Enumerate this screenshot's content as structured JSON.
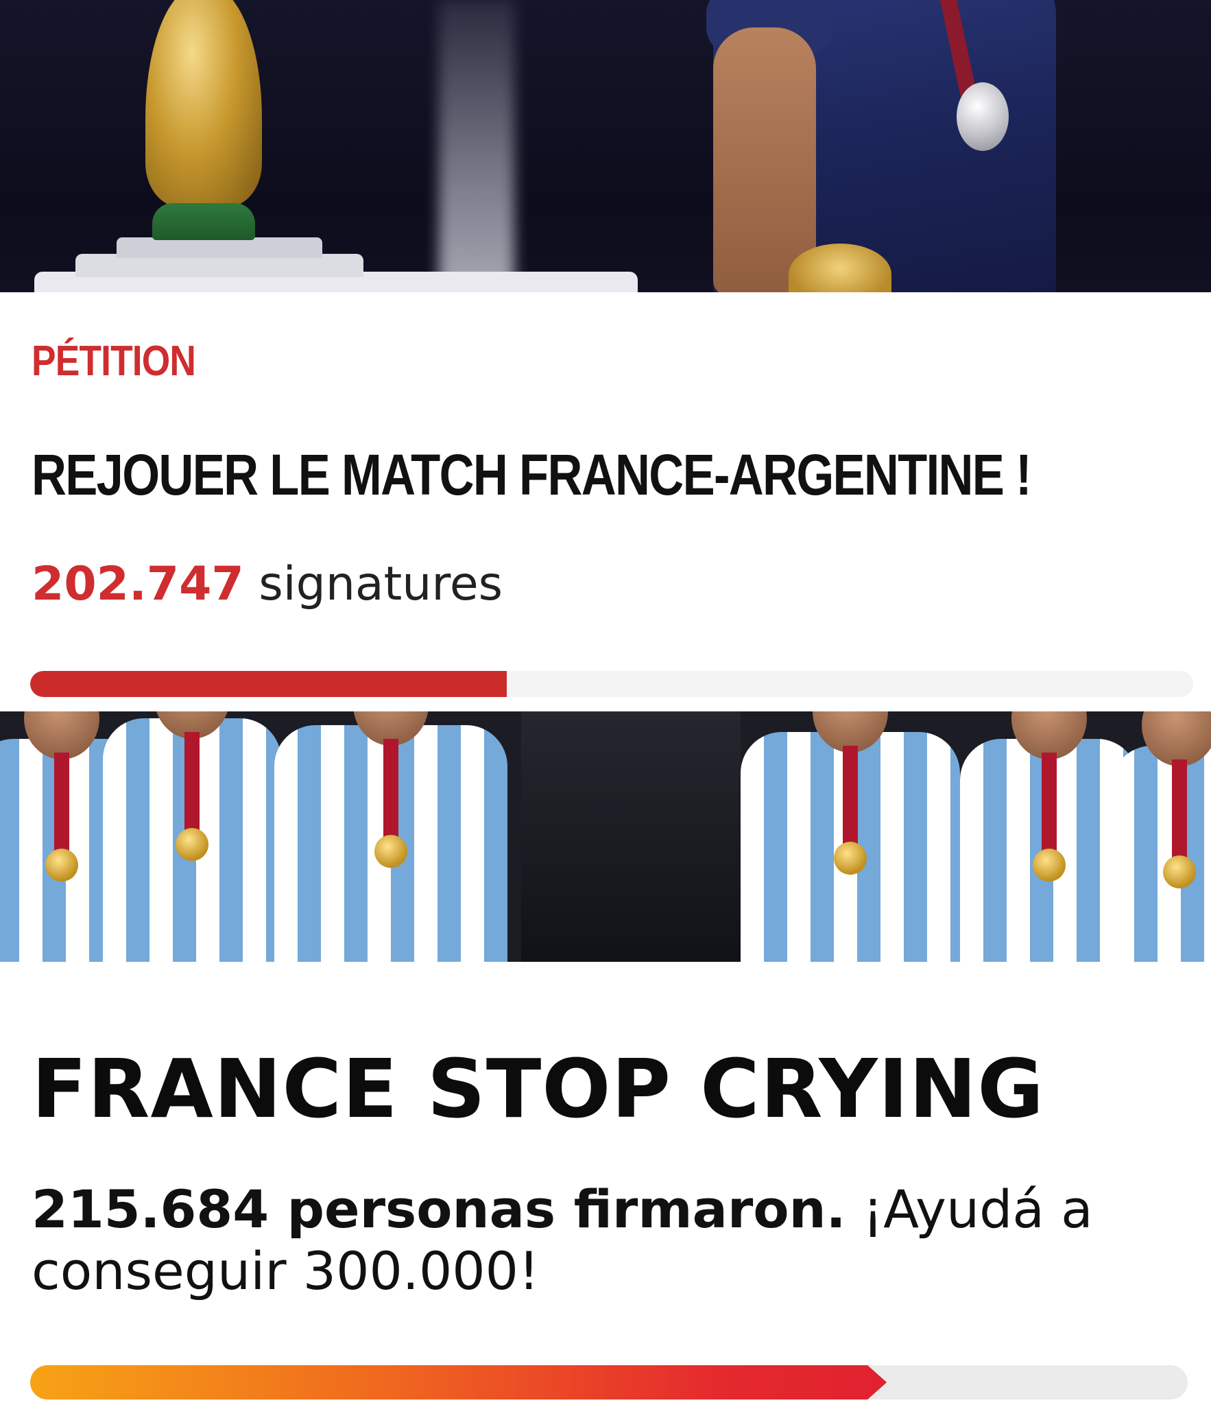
{
  "petition_one": {
    "label": "PÉTITION",
    "title": "REJOUER LE MATCH FRANCE-ARGENTINE !",
    "signature_count": "202.747",
    "signature_word": "signatures",
    "progress_fraction": 0.41,
    "accent_color": "#cf2d2f"
  },
  "petition_two": {
    "title": "FRANCE STOP CRYING",
    "signed_bold": "215.684 personas firmaron.",
    "signed_rest": " ¡Ayudá a conseguir 300.000!",
    "progress_fraction": 0.74,
    "progress_colors": [
      "#f7a315",
      "#e0222f"
    ]
  }
}
